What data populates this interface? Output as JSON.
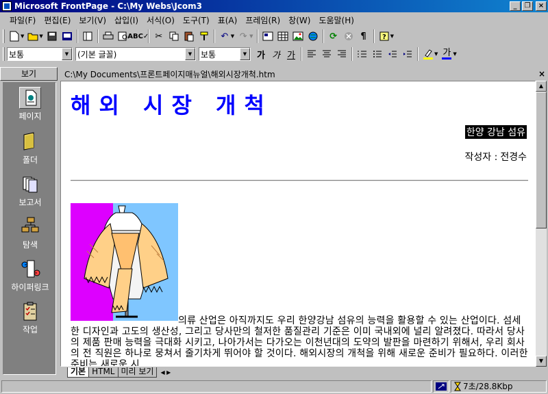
{
  "window": {
    "title": "Microsoft FrontPage - C:\\My Webs\\Jcom3"
  },
  "menu": [
    "파일(F)",
    "편집(E)",
    "보기(V)",
    "삽입(I)",
    "서식(O)",
    "도구(T)",
    "표(A)",
    "프레임(R)",
    "창(W)",
    "도움말(H)"
  ],
  "format": {
    "style": "보통",
    "font": "(기본 글꼴)",
    "size": "보통",
    "bold_label": "가",
    "italic_label": "가",
    "underline_label": "가",
    "font_color_label": "가"
  },
  "views_bar": {
    "header": "보기",
    "items": [
      "페이지",
      "폴더",
      "보고서",
      "탐색",
      "하이퍼링크",
      "작업"
    ]
  },
  "document": {
    "path": "C:\\My Documents\\프론트페이지매뉴얼\\해외시장개척.htm",
    "heading": "해외 시장 개척",
    "company": "한양 강남 섬유",
    "author_label": "작성자 :",
    "author_name": "전경수",
    "body": "의류 산업은 아직까지도 우리 한양강남 섬유의 능력을 활용할 수 있는 산업이다. 섬세한 디자인과 고도의 생산성, 그리고 당사만의 철저한 품질관리 기준은 이미 국내외에 널리 알려졌다. 따라서 당사의 제품 판매 능력을 극대화 시키고, 나아가서는 다가오는 이천년대의 도약의 발판을 마련하기 위해서, 우리 회사의 전 직원은 하나로 뭉쳐서 줄기차게 뛰어야 할 것이다. 해외시장의 개척을 위해 새로운 준비가 필요하다. 이러한 준비는 새로운 시"
  },
  "tabs": [
    "기본",
    "HTML",
    "미리 보기"
  ],
  "status": {
    "download_time": "7초/28.8Kbp"
  },
  "colors": {
    "titlebar": "#000080",
    "heading": "#0000ff",
    "figure_magenta": "#dd00ff",
    "figure_sky": "#7fc6ff"
  }
}
